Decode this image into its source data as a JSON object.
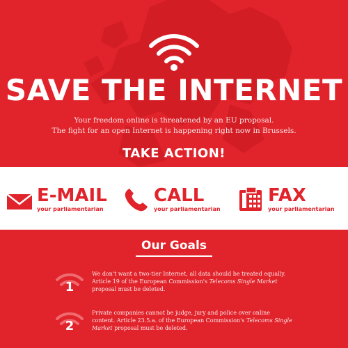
{
  "hero": {
    "title": "SAVE THE INTERNET",
    "subtitle_line1": "Your freedom online is threatened by an EU proposal.",
    "subtitle_line2": "The fight for an open Internet is happening right now in Brussels.",
    "take_action": "TAKE ACTION!"
  },
  "actions": [
    {
      "label": "E-MAIL",
      "sub": "your parliamentarian",
      "icon": "envelope-icon"
    },
    {
      "label": "CALL",
      "sub": "your parliamentarian",
      "icon": "phone-icon"
    },
    {
      "label": "FAX",
      "sub": "your parliamentarian",
      "icon": "fax-icon"
    }
  ],
  "goals": {
    "title": "Our Goals",
    "items": [
      {
        "number": "1",
        "text_a": "We don't want a two-tier Internet, all data should be treated equally. Article 19 of the European Commission's ",
        "text_italic": "Telecoms Single Market",
        "text_b": " proposal must be deleted."
      },
      {
        "number": "2",
        "text_a": "Private companies cannot be judge, jury and police over online content. Article 23.5.a. of the European Commission's ",
        "text_italic": "Telecoms Single Market",
        "text_b": " proposal must be deleted."
      }
    ]
  },
  "colors": {
    "brand_red": "#e1232b",
    "white": "#ffffff"
  }
}
